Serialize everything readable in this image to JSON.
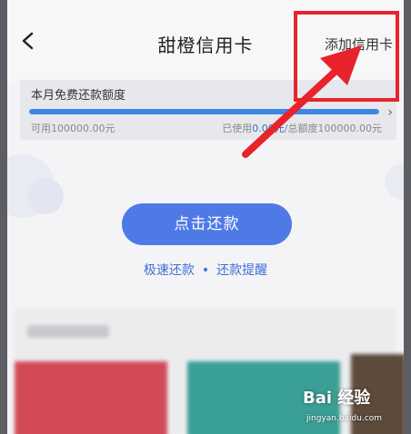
{
  "header": {
    "title": "甜橙信用卡",
    "add_card_label": "添加信用卡"
  },
  "quota": {
    "title": "本月免费还款额度",
    "available_text": "可用100000.00元",
    "used_prefix": "已使用",
    "used_value": "0.00元",
    "total_text": "/总额度100000.00元",
    "used_fraction": 1.0
  },
  "actions": {
    "repay_label": "点击还款",
    "fast_repay_label": "极速还款",
    "separator": "•",
    "reminder_label": "还款提醒"
  },
  "watermark": {
    "logo_text": "Bai 经验",
    "site": "jingyan.baidu.com"
  },
  "colors": {
    "primary": "#4f7ae6",
    "progress": "#3e86e5",
    "annotation": "#e8232b"
  }
}
